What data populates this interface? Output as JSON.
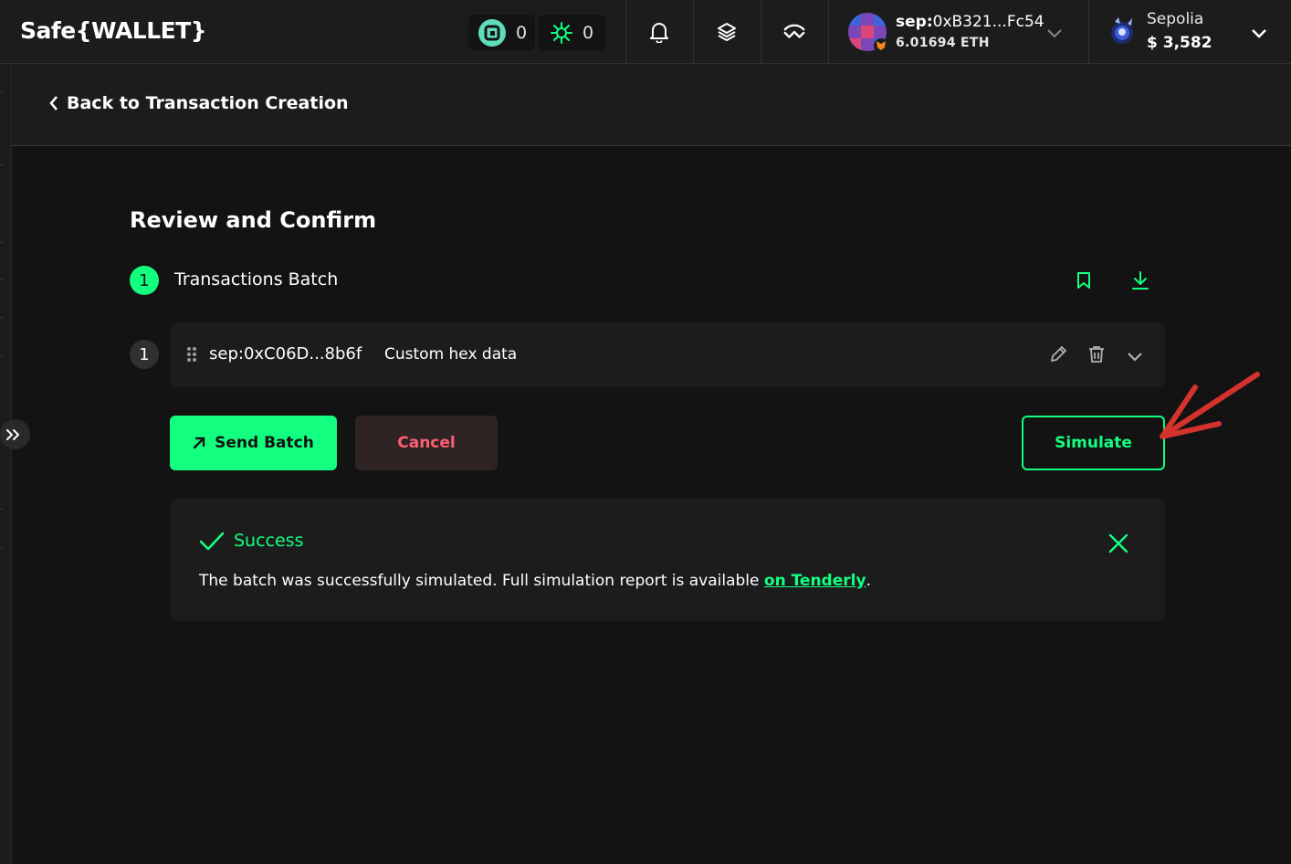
{
  "header": {
    "logo": "Safe{WALLET}",
    "counters": [
      {
        "icon": "safe-token-icon",
        "value": "0"
      },
      {
        "icon": "star-burst-icon",
        "value": "0"
      }
    ],
    "account": {
      "prefix": "sep:",
      "address": "0xB321...Fc54",
      "balance": "6.01694 ETH"
    },
    "network": {
      "name": "Sepolia",
      "value": "$ 3,582"
    }
  },
  "subheader": {
    "back_label": "Back to Transaction Creation"
  },
  "main": {
    "title": "Review and Confirm",
    "step_number": "1",
    "batch_title": "Transactions Batch",
    "transactions": [
      {
        "index": "1",
        "address": "sep:0xC06D...8b6f",
        "type": "Custom hex data"
      }
    ],
    "send_label": "Send Batch",
    "cancel_label": "Cancel",
    "simulate_label": "Simulate"
  },
  "alert": {
    "title": "Success",
    "text": "The batch was successfully simulated. Full simulation report is available ",
    "link": "on Tenderly",
    "suffix": "."
  },
  "colors": {
    "accent": "#12ff80",
    "danger": "#ff5f72",
    "background": "#121312",
    "surface": "#1c1c1c",
    "annotation": "#d4322c"
  }
}
